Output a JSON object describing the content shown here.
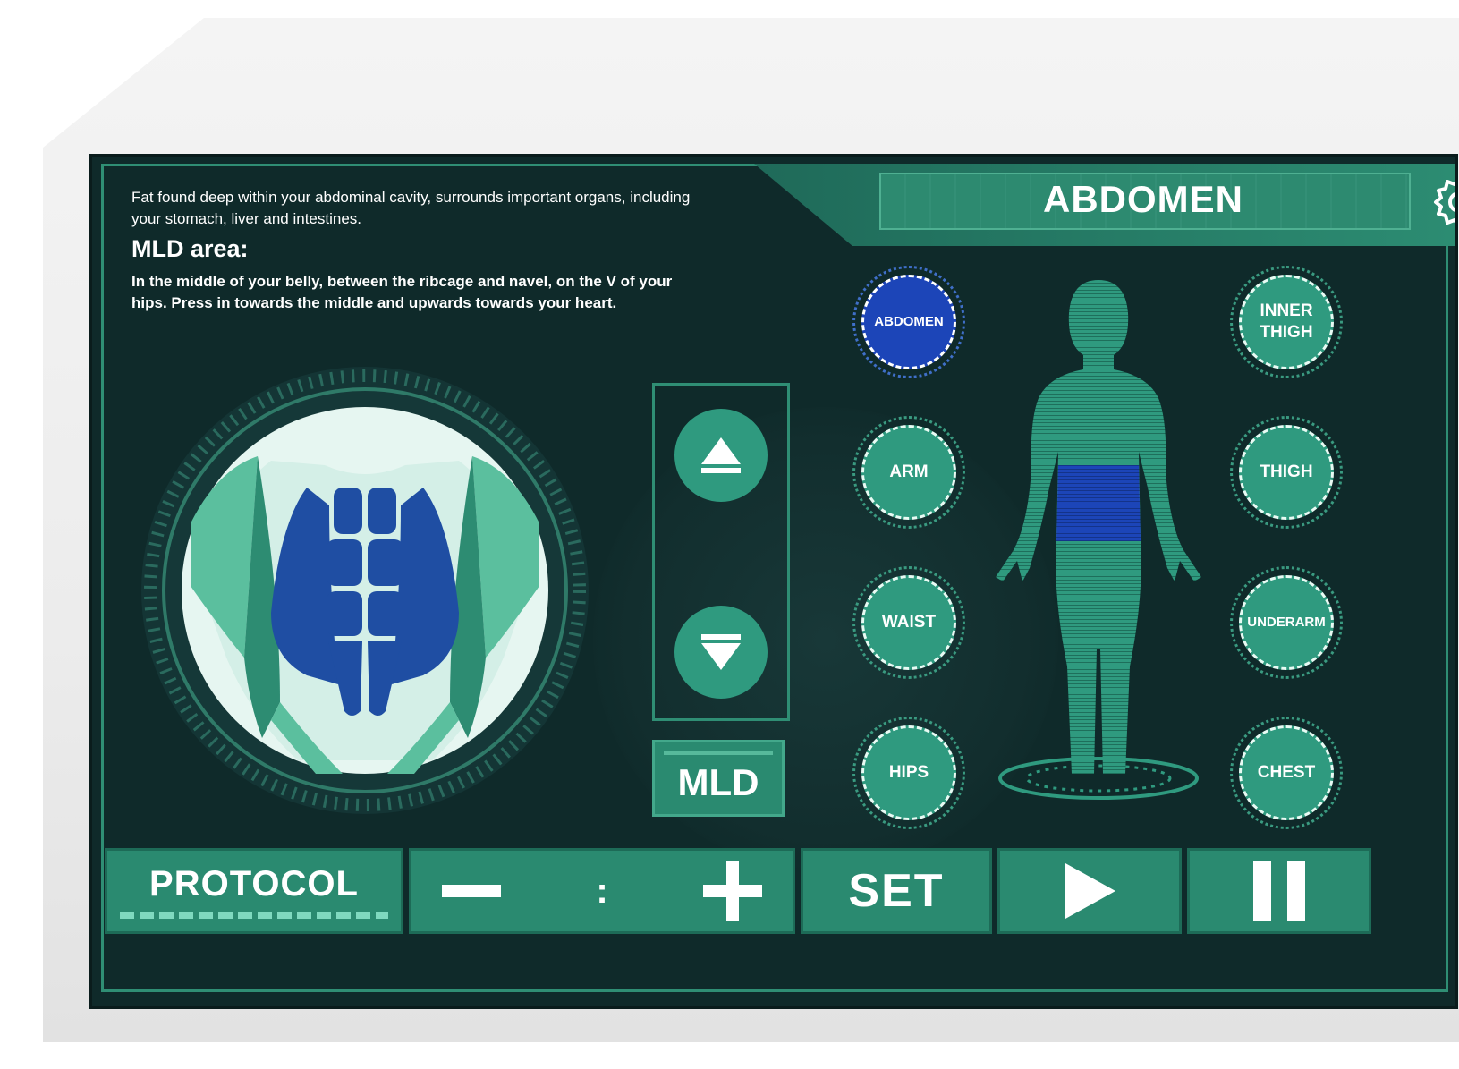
{
  "header": {
    "title": "ABDOMEN"
  },
  "info": {
    "description": "Fat found deep within your abdominal cavity, surrounds important organs, including your stomach, liver and intestines.",
    "mld_heading": "MLD area:",
    "mld_description": "In the middle of your belly, between the ribcage and navel, on the V of your hips. Press in towards the middle and upwards towards your heart."
  },
  "controls": {
    "mld_label": "MLD"
  },
  "zones": {
    "left": [
      "ABDOMEN",
      "ARM",
      "WAIST",
      "HIPS"
    ],
    "right": [
      "INNER THIGH",
      "THIGH",
      "UNDERARM",
      "CHEST"
    ],
    "selected": "ABDOMEN"
  },
  "toolbar": {
    "protocol_label": "PROTOCOL",
    "time_separator": ":",
    "set_label": "SET"
  },
  "icons": {
    "settings": "gear-icon",
    "up": "triangle-up-icon",
    "down": "triangle-down-icon",
    "minus": "minus-icon",
    "plus": "plus-icon",
    "play": "play-icon",
    "pause": "pause-icon"
  },
  "colors": {
    "screen_bg": "#0f2a2a",
    "accent": "#2f9a7f",
    "selected": "#1c45b8",
    "text": "#ffffff"
  }
}
